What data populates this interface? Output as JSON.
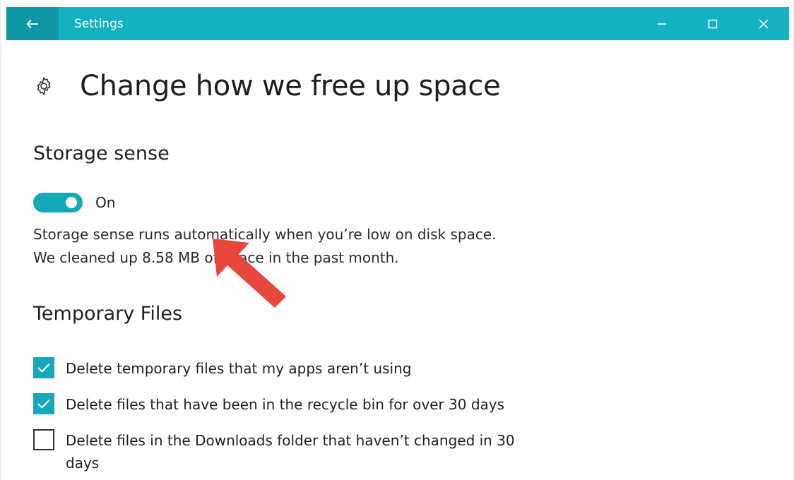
{
  "window": {
    "title": "Settings",
    "accent_color": "#15b1c1",
    "back_icon": "arrow-left-icon",
    "controls": [
      "minimize-icon",
      "maximize-icon",
      "close-icon"
    ]
  },
  "page": {
    "icon": "gear-icon",
    "title": "Change how we free up space"
  },
  "storage_sense": {
    "heading": "Storage sense",
    "toggle_state": "On",
    "description_line1": "Storage sense runs automatically when you’re low on disk space.",
    "description_line2": "We cleaned up 8.58 MB of space in the past month."
  },
  "temporary_files": {
    "heading": "Temporary Files",
    "options": [
      {
        "label": "Delete temporary files that my apps aren’t using",
        "checked": true
      },
      {
        "label": "Delete files that have been in the recycle bin for over 30 days",
        "checked": true
      },
      {
        "label": "Delete files in the Downloads folder that haven’t changed in 30 days",
        "checked": false
      }
    ]
  },
  "annotation": {
    "arrow_color": "#e8473b"
  }
}
